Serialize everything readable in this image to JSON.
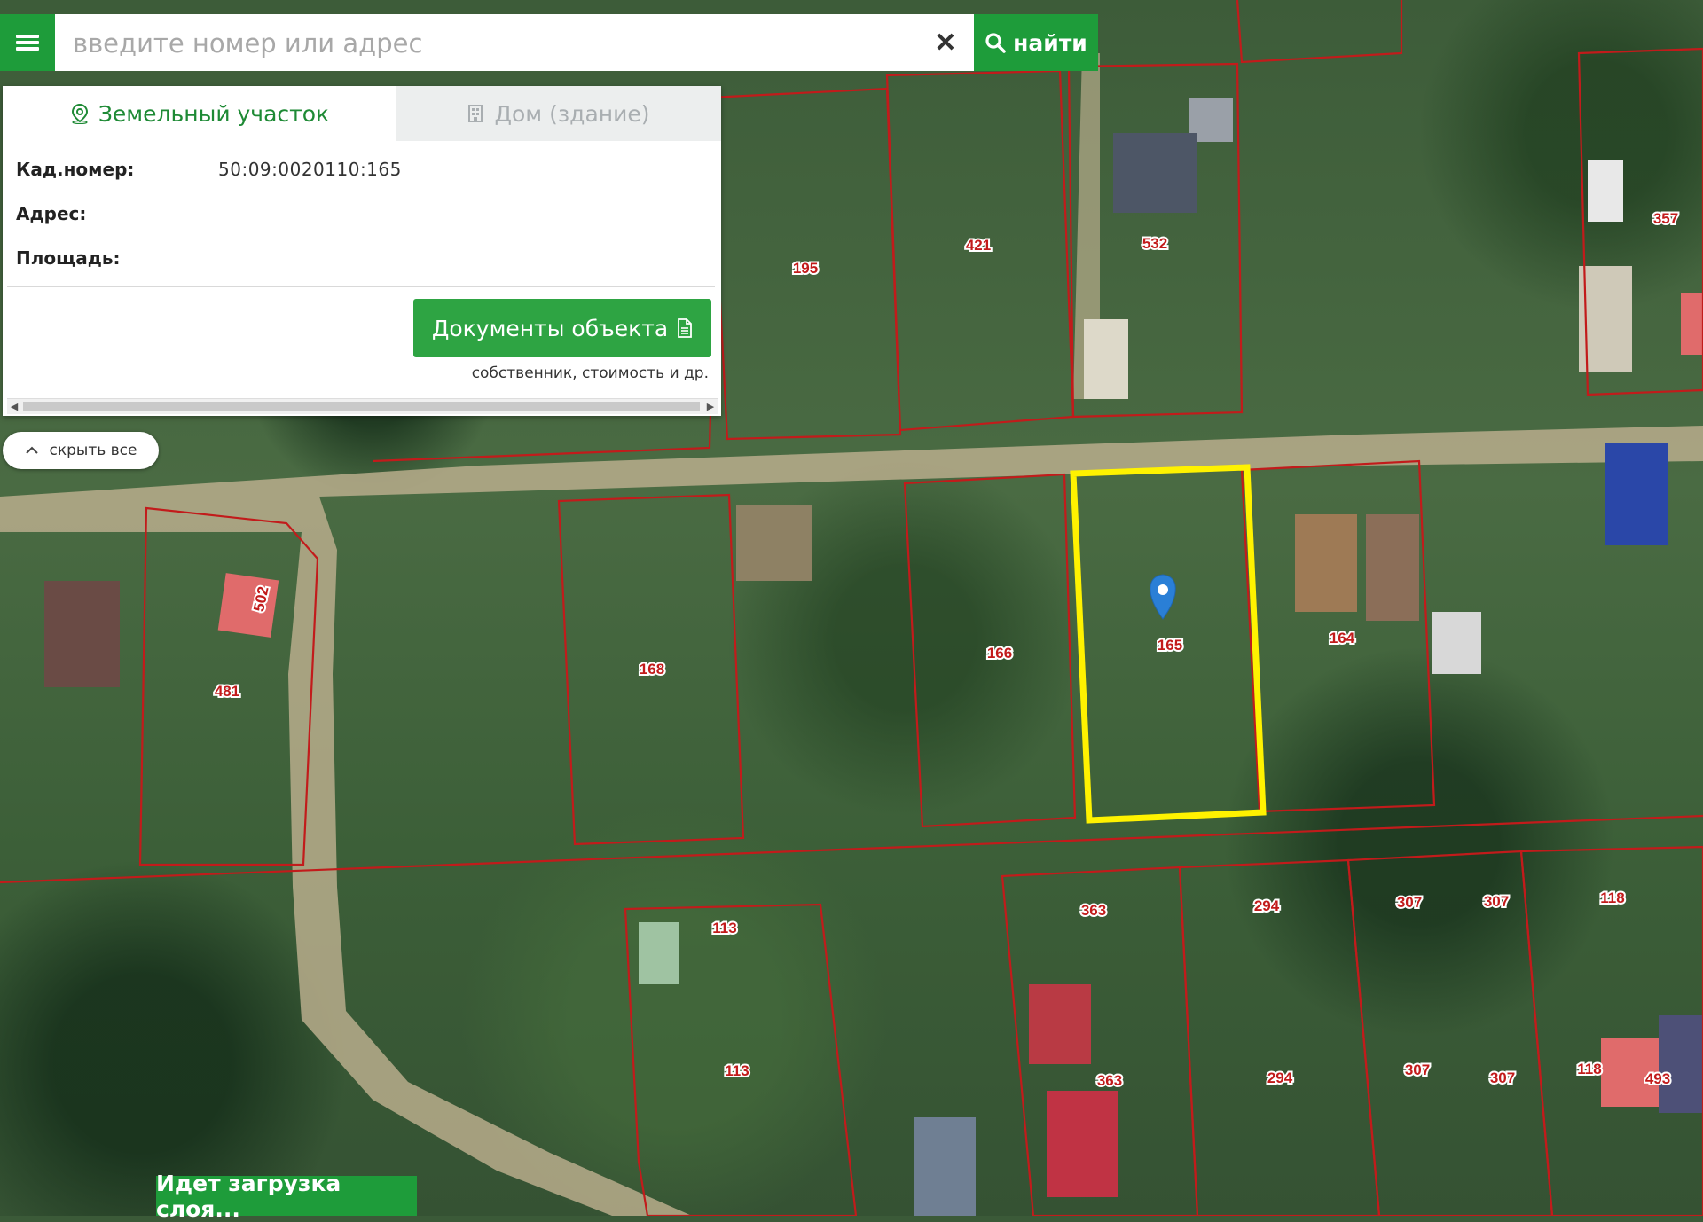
{
  "search": {
    "placeholder": "введите номер или адрес",
    "value": "",
    "clear_icon": "close-icon",
    "find_label": "найти"
  },
  "panel": {
    "tabs": [
      {
        "label": "Земельный участок",
        "icon": "location-pin-icon",
        "active": true
      },
      {
        "label": "Дом (здание)",
        "icon": "building-icon",
        "active": false
      }
    ],
    "fields": [
      {
        "label": "Кад.номер:",
        "value": "50:09:0020110:165"
      },
      {
        "label": "Адрес:",
        "value": ""
      },
      {
        "label": "Площадь:",
        "value": ""
      }
    ],
    "docs_button": "Документы объекта",
    "docs_hint": "собственник, стоимость и др."
  },
  "hide_all": "скрыть все",
  "loading": "Идет загрузка слоя...",
  "map": {
    "selected_parcel": "165",
    "parcel_labels": [
      "195",
      "421",
      "532",
      "357",
      "168",
      "166",
      "165",
      "164",
      "502",
      "481",
      "113",
      "113",
      "363",
      "363",
      "294",
      "294",
      "307",
      "307",
      "307",
      "307",
      "118",
      "118",
      "493"
    ]
  },
  "colors": {
    "accent_green": "#1e9c3a",
    "parcel_border": "#c21b1b",
    "highlight": "#fff200",
    "marker": "#2a7fd6"
  }
}
